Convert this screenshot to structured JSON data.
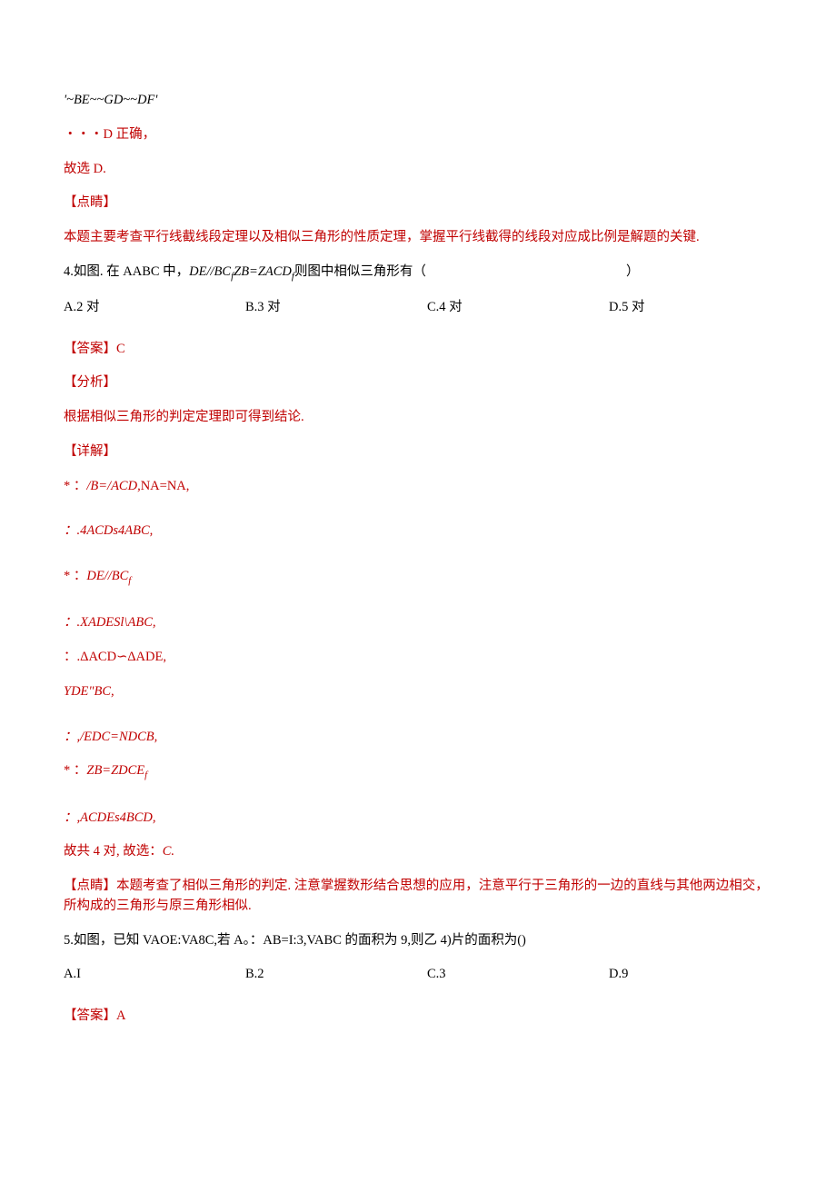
{
  "l01": "'~BE~~GD~~DF'",
  "l02": "・・・D 正确，",
  "l03": "故选 D.",
  "l04": "【点睛】",
  "l05": "本题主要考查平行线截线段定理以及相似三角形的性质定理，掌握平行线截得的线段对应成比例是解题的关键.",
  "q4_pre": "4.如图. 在 AABC 中，",
  "q4_ital": "DE//BC",
  "q4_sub": "f",
  "q4_mid": "ZB=ZACD",
  "q4_sub2": "f",
  "q4_post": "则图中相似三角形有（",
  "q4_close": "）",
  "q4_optA": "A.2 对",
  "q4_optB": "B.3 对",
  "q4_optC": "C.4 对",
  "q4_optD": "D.5 对",
  "ans4": "【答案】C",
  "an4": "【分析】",
  "an4b": "根据相似三角形的判定定理即可得到结论.",
  "det4": "【详解】",
  "d4_1a": "* ：",
  "d4_1b": "/B=/ACD,",
  "d4_1c": "NA=NA,",
  "d4_2": "：.4ACDs4ABC,",
  "d4_3a": "* ：",
  "d4_3b": "DE//BC",
  "d4_3sub": "f",
  "d4_4": "：.XADESl\\ABC,",
  "d4_5": "：.ΔACD∽ΔADE,",
  "d4_6": "YDE\"BC,",
  "d4_7": "：,/EDC=NDCB,",
  "d4_8a": "* ：",
  "d4_8b": "ZB=ZDCE",
  "d4_8sub": "f",
  "d4_9": "：,ACDEs4BCD,",
  "d4_10a": "故共 4 对, 故选：",
  "d4_10b": "C.",
  "tip4a": "【点睛】",
  "tip4b": "本题考查了相似三角形的判定. 注意掌握数形结合思想的应用，注意平行于三角形的一边的直线与其他两边相交，所构成的三角形与原三角形相似.",
  "q5": "5.如图，已知 VAOE:VA8C,若 A。：AB=I:3,VABC 的面积为 9,则乙 4)片的面积为()",
  "q5_optA": "A.I",
  "q5_optB": "B.2",
  "q5_optC": "C.3",
  "q5_optD": "D.9",
  "ans5": "【答案】A"
}
